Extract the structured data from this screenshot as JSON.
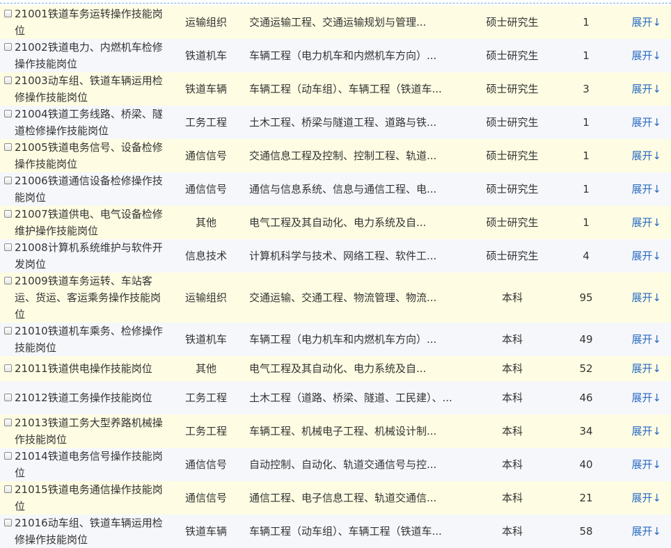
{
  "expand_label": "展开↓",
  "rows": [
    {
      "name": "21001铁道车务运转操作技能岗位",
      "category": "运输组织",
      "major": "交通运输工程、交通运输规划与管理...",
      "education": "硕士研究生",
      "count": "1"
    },
    {
      "name": "21002铁道电力、内燃机车检修操作技能岗位",
      "category": "铁道机车",
      "major": "车辆工程（电力机车和内燃机车方向）...",
      "education": "硕士研究生",
      "count": "1"
    },
    {
      "name": "21003动车组、铁道车辆运用检修操作技能岗位",
      "category": "铁道车辆",
      "major": "车辆工程（动车组）、车辆工程（铁道车...",
      "education": "硕士研究生",
      "count": "3"
    },
    {
      "name": "21004铁道工务线路、桥梁、隧道检修操作技能岗位",
      "category": "工务工程",
      "major": "土木工程、桥梁与隧道工程、道路与铁...",
      "education": "硕士研究生",
      "count": "1"
    },
    {
      "name": "21005铁道电务信号、设备检修操作技能岗位",
      "category": "通信信号",
      "major": "交通信息工程及控制、控制工程、轨道...",
      "education": "硕士研究生",
      "count": "1"
    },
    {
      "name": "21006铁道通信设备检修操作技能岗位",
      "category": "通信信号",
      "major": "通信与信息系统、信息与通信工程、电...",
      "education": "硕士研究生",
      "count": "1"
    },
    {
      "name": "21007铁道供电、电气设备检修维护操作技能岗位",
      "category": "其他",
      "major": "电气工程及其自动化、电力系统及自...",
      "education": "硕士研究生",
      "count": "1"
    },
    {
      "name": "21008计算机系统维护与软件开发岗位",
      "category": "信息技术",
      "major": "计算机科学与技术、网络工程、软件工...",
      "education": "硕士研究生",
      "count": "4"
    },
    {
      "name": "21009铁道车务运转、车站客运、货运、客运乘务操作技能岗位",
      "category": "运输组织",
      "major": "交通运输、交通工程、物流管理、物流...",
      "education": "本科",
      "count": "95"
    },
    {
      "name": "21010铁道机车乘务、检修操作技能岗位",
      "category": "铁道机车",
      "major": "车辆工程（电力机车和内燃机车方向）...",
      "education": "本科",
      "count": "49"
    },
    {
      "name": "21011铁道供电操作技能岗位",
      "category": "其他",
      "major": "电气工程及其自动化、电力系统及自...",
      "education": "本科",
      "count": "52"
    },
    {
      "name": "21012铁道工务操作技能岗位",
      "category": "工务工程",
      "major": "土木工程（道路、桥梁、隧道、工民建）、...",
      "education": "本科",
      "count": "46",
      "wrap": true
    },
    {
      "name": "21013铁道工务大型养路机械操作技能岗位",
      "category": "工务工程",
      "major": "车辆工程、机械电子工程、机械设计制...",
      "education": "本科",
      "count": "34"
    },
    {
      "name": "21014铁道电务信号操作技能岗位",
      "category": "通信信号",
      "major": "自动控制、自动化、轨道交通信号与控...",
      "education": "本科",
      "count": "40"
    },
    {
      "name": "21015铁道电务通信操作技能岗位",
      "category": "通信信号",
      "major": "通信工程、电子信息工程、轨道交通信...",
      "education": "本科",
      "count": "21"
    },
    {
      "name": "21016动车组、铁道车辆运用检修操作技能岗位",
      "category": "铁道车辆",
      "major": "车辆工程（动车组）、车辆工程（铁道车...",
      "education": "本科",
      "count": "58"
    }
  ]
}
